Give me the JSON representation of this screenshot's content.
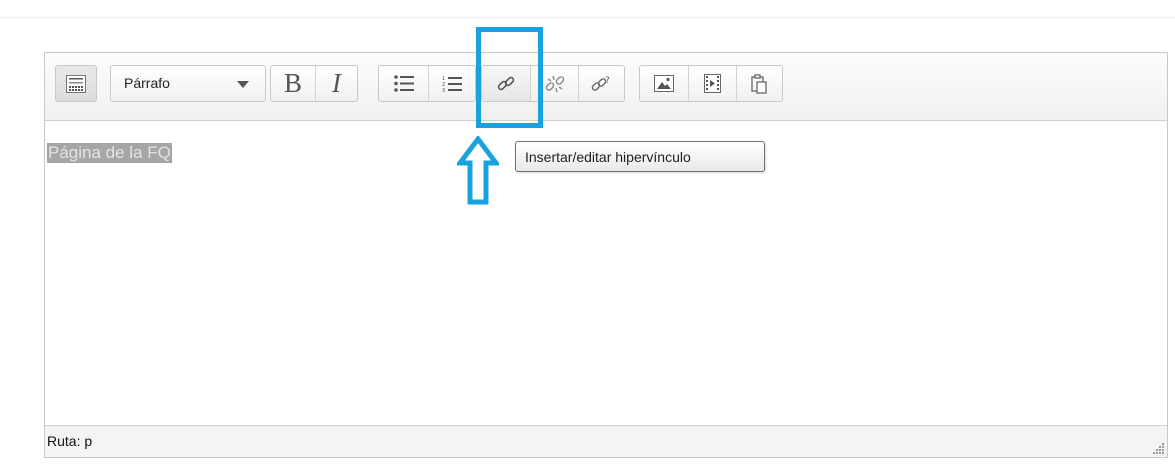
{
  "toolbar": {
    "format_select": {
      "value": "Párrafo"
    },
    "bold_label": "B",
    "italic_label": "I",
    "buttons": [
      {
        "name": "kitchen-sink",
        "icon": "toolbar-toggle-icon"
      },
      {
        "name": "bold",
        "icon": "bold-icon"
      },
      {
        "name": "italic",
        "icon": "italic-icon"
      },
      {
        "name": "unordered-list",
        "icon": "bullet-list-icon"
      },
      {
        "name": "ordered-list",
        "icon": "numbered-list-icon"
      },
      {
        "name": "insert-link",
        "icon": "link-icon"
      },
      {
        "name": "remove-link",
        "icon": "unlink-icon"
      },
      {
        "name": "auto-link",
        "icon": "link-help-icon"
      },
      {
        "name": "insert-image",
        "icon": "image-icon"
      },
      {
        "name": "insert-media",
        "icon": "media-icon"
      },
      {
        "name": "paste",
        "icon": "paste-icon"
      }
    ]
  },
  "content": {
    "text": "Página de la FQ",
    "selected": true
  },
  "tooltip": {
    "text": "Insertar/editar hipervínculo"
  },
  "statusbar": {
    "path": "Ruta: p"
  },
  "colors": {
    "highlight": "#1aa1df",
    "selection_bg": "#a6a6a6",
    "selection_text": "#e4e4e4"
  }
}
